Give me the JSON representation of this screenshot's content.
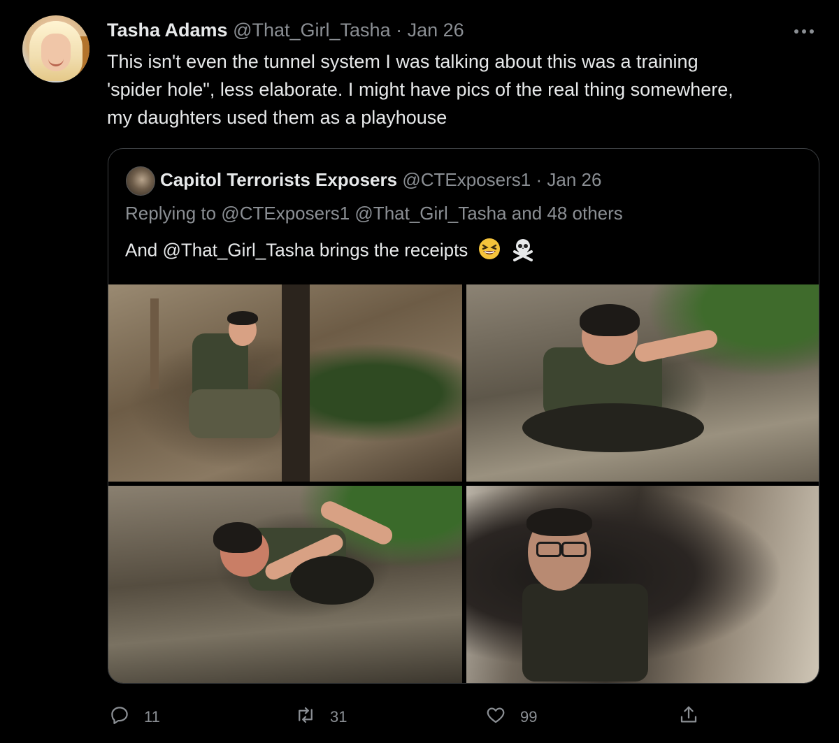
{
  "tweet": {
    "author_name": "Tasha Adams",
    "author_handle": "@That_Girl_Tasha",
    "separator": "·",
    "date": "Jan 26",
    "more_icon": "more-horizontal-icon",
    "text": "This isn't even the tunnel system I was talking about this was a training\n'spider hole\", less elaborate. I might have pics of the real thing somewhere,\nmy daughters used them as a playhouse"
  },
  "quoted_tweet": {
    "author_name": "Capitol Terrorists Exposers",
    "author_handle": "@CTExposers1",
    "separator": "·",
    "date": "Jan 26",
    "replying_to": "Replying to @CTExposers1 @That_Girl_Tasha and 48 others",
    "text": "And @That_Girl_Tasha brings the receipts",
    "emojis": [
      "laughing-face-icon",
      "skull-crossbones-icon"
    ],
    "photos": [
      {
        "icon": "photo-man-kneeling-forest"
      },
      {
        "icon": "photo-man-in-hole-reaching"
      },
      {
        "icon": "photo-man-in-hole-lying"
      },
      {
        "icon": "photo-man-in-tunnel-glasses"
      }
    ]
  },
  "actions": {
    "reply_count": "11",
    "retweet_count": "31",
    "like_count": "99",
    "icons": [
      "reply-icon",
      "retweet-icon",
      "like-icon",
      "share-icon"
    ]
  },
  "colors": {
    "background": "#000000",
    "text": "#e7e9ea",
    "muted": "#8b8f94",
    "border": "#3e4144"
  }
}
